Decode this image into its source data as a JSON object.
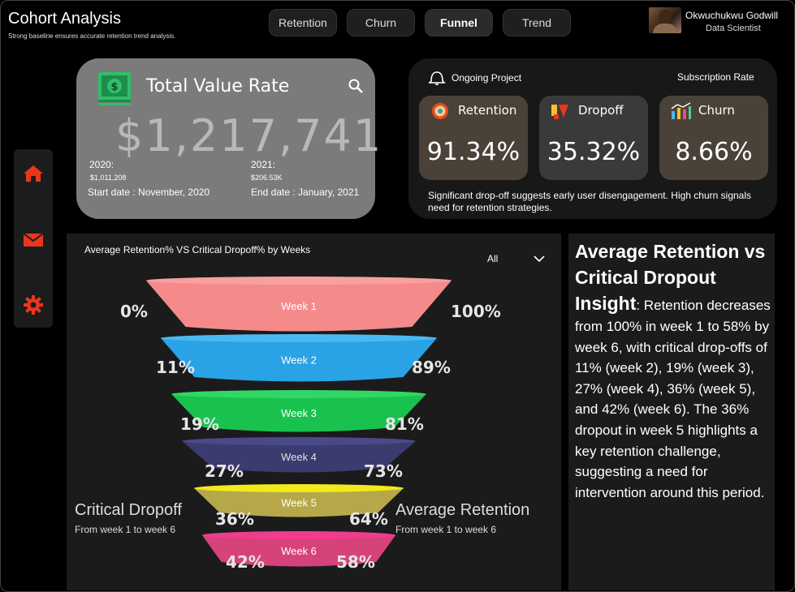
{
  "header": {
    "title": "Cohort Analysis",
    "subtitle": "Strong  baseline ensures accurate retention trend analysis.",
    "tabs": [
      {
        "label": "Retention"
      },
      {
        "label": "Churn"
      },
      {
        "label": "Funnel"
      },
      {
        "label": "Trend"
      }
    ],
    "active_tab": "Funnel"
  },
  "user": {
    "name": "Okwuchukwu Godwill",
    "role": "Data Scientist"
  },
  "sidebar": {
    "icons": [
      "home-icon",
      "mail-icon",
      "settings-icon"
    ],
    "icon_color": "#e8371d"
  },
  "total_value": {
    "title": "Total Value Rate",
    "value": "$1,217,741",
    "year_2020_label": "2020:",
    "year_2020_value": "$1,011,208",
    "start_date": "Start date : November, 2020",
    "year_2021_label": "2021:",
    "year_2021_value": "$206.53K",
    "end_date": "End date : January, 2021"
  },
  "project": {
    "label": "Ongoing Project",
    "rate_label": "Subscription Rate",
    "metrics": [
      {
        "label": "Retention",
        "value": "91.34%",
        "color": "#4a4238"
      },
      {
        "label": "Dropoff",
        "value": "35.32%",
        "color": "#3a3a3a"
      },
      {
        "label": "Churn",
        "value": "8.66%",
        "color": "#4a4238"
      }
    ],
    "note": "Significant drop-off suggests early user disengagement. High churn signals need for retention strategies."
  },
  "funnel": {
    "title": "Average Retention% VS Critical Dropoff% by Weeks",
    "filter_value": "All",
    "left_caption": "Critical Dropoff",
    "left_sub": "From week 1 to week 6",
    "right_caption": "Average Retention",
    "right_sub": "From week 1 to week 6"
  },
  "chart_data": {
    "type": "funnel",
    "title": "Average Retention% VS Critical Dropoff% by Weeks",
    "categories": [
      "Week 1",
      "Week 2",
      "Week 3",
      "Week 4",
      "Week 5",
      "Week 6"
    ],
    "series": [
      {
        "name": "Average Retention",
        "values": [
          100,
          89,
          81,
          73,
          64,
          58
        ]
      },
      {
        "name": "Critical Dropoff",
        "values": [
          0,
          11,
          19,
          27,
          36,
          42
        ]
      }
    ],
    "retention_labels": [
      "100%",
      "89%",
      "81%",
      "73%",
      "64%",
      "58%"
    ],
    "dropoff_labels": [
      "0%",
      "11%",
      "19%",
      "27%",
      "36%",
      "42%"
    ],
    "colors": [
      "#f58a8a",
      "#29a3e6",
      "#19c24f",
      "#3b3b70",
      "#b6a84a",
      "#d6427a"
    ],
    "top_colors": [
      "#f7a0a0",
      "#4cb8f2",
      "#30d764",
      "#4a4a88",
      "#f2ea1a",
      "#f03c8c"
    ]
  },
  "insight": {
    "heading": "Average Retention vs Critical Dropout Insight",
    "body": ": Retention decreases from 100% in week 1 to 58% by week 6, with critical drop-offs of 11% (week 2), 19% (week 3), 27% (week 4), 36% (week 5), and 42% (week 6). The 36% dropout in week 5 highlights a key retention challenge, suggesting a need for intervention around this period."
  }
}
